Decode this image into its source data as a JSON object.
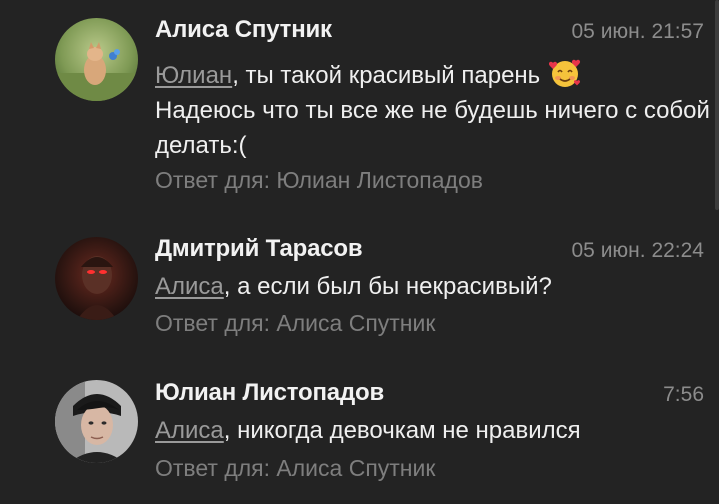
{
  "comments": [
    {
      "author": "Алиса Спутник",
      "time": "05 июн. 21:57",
      "avatar_icon": "avatar-cat-photo",
      "mention": "Юлиан",
      "text_line1": ", ты такой красивый парень",
      "emoji": "smiling-face-with-hearts",
      "text_rest": "Надеюсь что ты все же не будешь ничего с собой делать:(",
      "reply_to": "Ответ для: Юлиан Листопадов"
    },
    {
      "author": "Дмитрий Тарасов",
      "time": "05 июн. 22:24",
      "avatar_icon": "avatar-red-eyes-photo",
      "mention": "Алиса",
      "text": ", а если был бы некрасивый?",
      "reply_to": "Ответ для: Алиса Спутник"
    },
    {
      "author": "Юлиан Листопадов",
      "time": "7:56",
      "avatar_icon": "avatar-man-photo",
      "mention": "Алиса",
      "text": ", никогда девочкам не нравился",
      "reply_to": "Ответ для: Алиса Спутник"
    }
  ],
  "colors": {
    "background": "#232323",
    "author": "#f2f2f2",
    "text": "#efefef",
    "muted": "#8c8c8c",
    "mention": "#9a9a9a"
  }
}
